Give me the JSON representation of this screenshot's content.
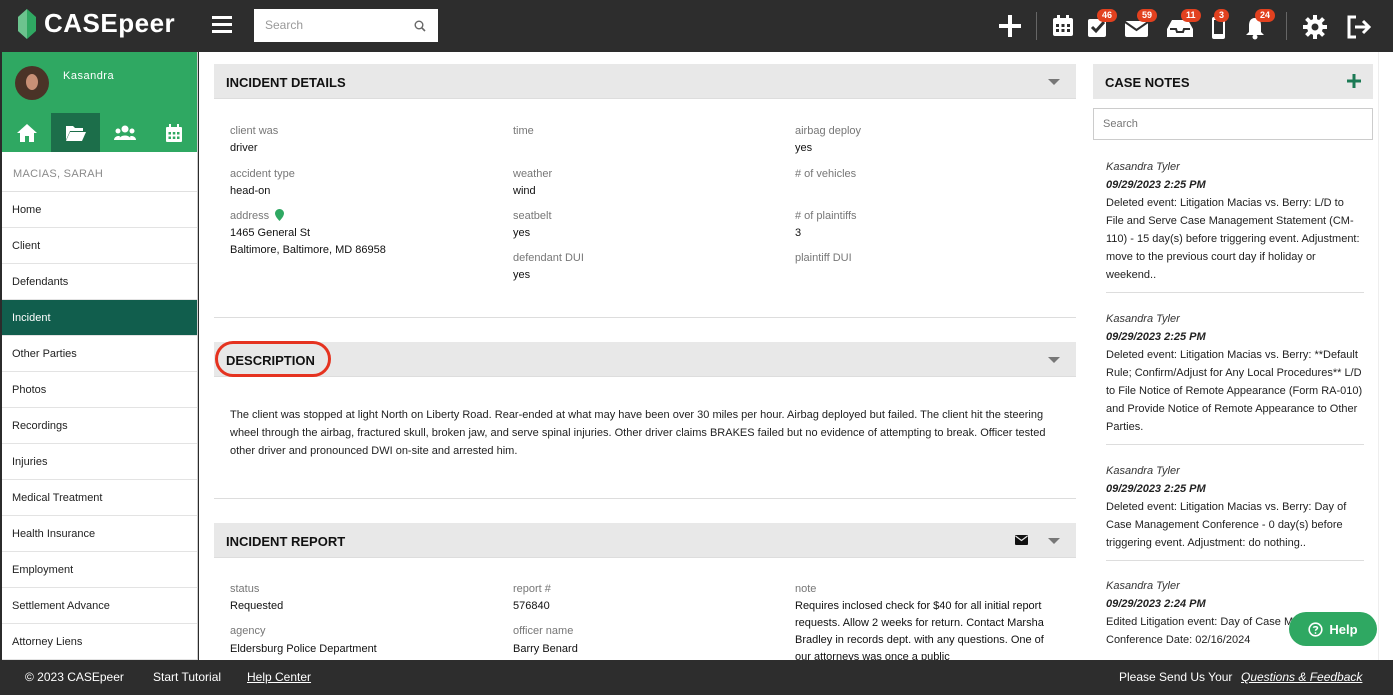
{
  "app": {
    "brand": "CASEpeer"
  },
  "topbar": {
    "search_placeholder": "Search",
    "badges": {
      "tasks": "46",
      "mail": "59",
      "inbox": "11",
      "phone": "3",
      "alerts": "24"
    }
  },
  "sidebar": {
    "user_name": "Kasandra",
    "case_name": "MACIAS, SARAH",
    "items": [
      {
        "label": "Home"
      },
      {
        "label": "Client"
      },
      {
        "label": "Defendants"
      },
      {
        "label": "Incident"
      },
      {
        "label": "Other Parties"
      },
      {
        "label": "Photos"
      },
      {
        "label": "Recordings"
      },
      {
        "label": "Injuries"
      },
      {
        "label": "Medical Treatment"
      },
      {
        "label": "Health Insurance"
      },
      {
        "label": "Employment"
      },
      {
        "label": "Settlement Advance"
      },
      {
        "label": "Attorney Liens"
      }
    ]
  },
  "incident_details": {
    "title": "INCIDENT DETAILS",
    "client_was": {
      "label": "client was",
      "value": "driver"
    },
    "accident_type": {
      "label": "accident type",
      "value": "head-on"
    },
    "address": {
      "label": "address",
      "line1": "1465 General St",
      "line2": "Baltimore, Baltimore, MD 86958"
    },
    "time": {
      "label": "time",
      "value": ""
    },
    "weather": {
      "label": "weather",
      "value": "wind"
    },
    "seatbelt": {
      "label": "seatbelt",
      "value": "yes"
    },
    "defendant_dui": {
      "label": "defendant DUI",
      "value": "yes"
    },
    "airbag_deploy": {
      "label": "airbag deploy",
      "value": "yes"
    },
    "num_vehicles": {
      "label": "# of vehicles",
      "value": ""
    },
    "num_plaintiffs": {
      "label": "# of plaintiffs",
      "value": "3"
    },
    "plaintiff_dui": {
      "label": "plaintiff DUI",
      "value": ""
    }
  },
  "description": {
    "title": "DESCRIPTION",
    "text": "The client was stopped at light North on Liberty Road. Rear-ended at what may have been over 30 miles per hour. Airbag deployed but failed. The client hit the steering wheel through the airbag, fractured skull, broken jaw, and serve spinal injuries. Other driver claims BRAKES failed but no evidence of attempting to break. Officer tested other driver and pronounced DWI on-site and arrested him."
  },
  "incident_report": {
    "title": "INCIDENT REPORT",
    "status": {
      "label": "status",
      "value": "Requested"
    },
    "agency": {
      "label": "agency",
      "value": "Eldersburg Police Department"
    },
    "report_num": {
      "label": "report #",
      "value": "576840"
    },
    "officer_name": {
      "label": "officer name",
      "value": "Barry Benard"
    },
    "note": {
      "label": "note",
      "value": "Requires inclosed check for $40 for all initial report requests. Allow 2 weeks for return. Contact Marsha Bradley in records dept. with any questions. One of our attorneys was once a public"
    }
  },
  "case_notes": {
    "title": "CASE NOTES",
    "search_placeholder": "Search",
    "notes": [
      {
        "author": "Kasandra Tyler",
        "date": "09/29/2023 2:25 PM",
        "text": "Deleted event: Litigation Macias vs. Berry: L/D to File and Serve Case Management Statement (CM-110) - 15 day(s) before triggering event. Adjustment: move to the previous court day if holiday or weekend.."
      },
      {
        "author": "Kasandra Tyler",
        "date": "09/29/2023 2:25 PM",
        "text": "Deleted event: Litigation Macias vs. Berry: **Default Rule; Confirm/Adjust for Any Local Procedures** L/D to File Notice of Remote Appearance (Form RA-010) and Provide Notice of Remote Appearance to Other Parties."
      },
      {
        "author": "Kasandra Tyler",
        "date": "09/29/2023 2:25 PM",
        "text": "Deleted event: Litigation Macias vs. Berry: Day of Case Management Conference - 0 day(s) before triggering event. Adjustment: do nothing.."
      },
      {
        "author": "Kasandra Tyler",
        "date": "09/29/2023 2:24 PM",
        "text": "Edited Litigation event: Day of Case Management Conference Date: 02/16/2024"
      }
    ],
    "help_label": "Help"
  },
  "footer": {
    "copyright": "© 2023 CASEpeer",
    "tutorial": "Start Tutorial",
    "help_center": "Help Center",
    "send_prefix": "Please Send Us Your",
    "feedback_link": "Questions & Feedback"
  },
  "colors": {
    "brand_green": "#2fa862",
    "active_nav": "#115e4d",
    "badge_red": "#e2411f",
    "highlight": "#e53320"
  }
}
